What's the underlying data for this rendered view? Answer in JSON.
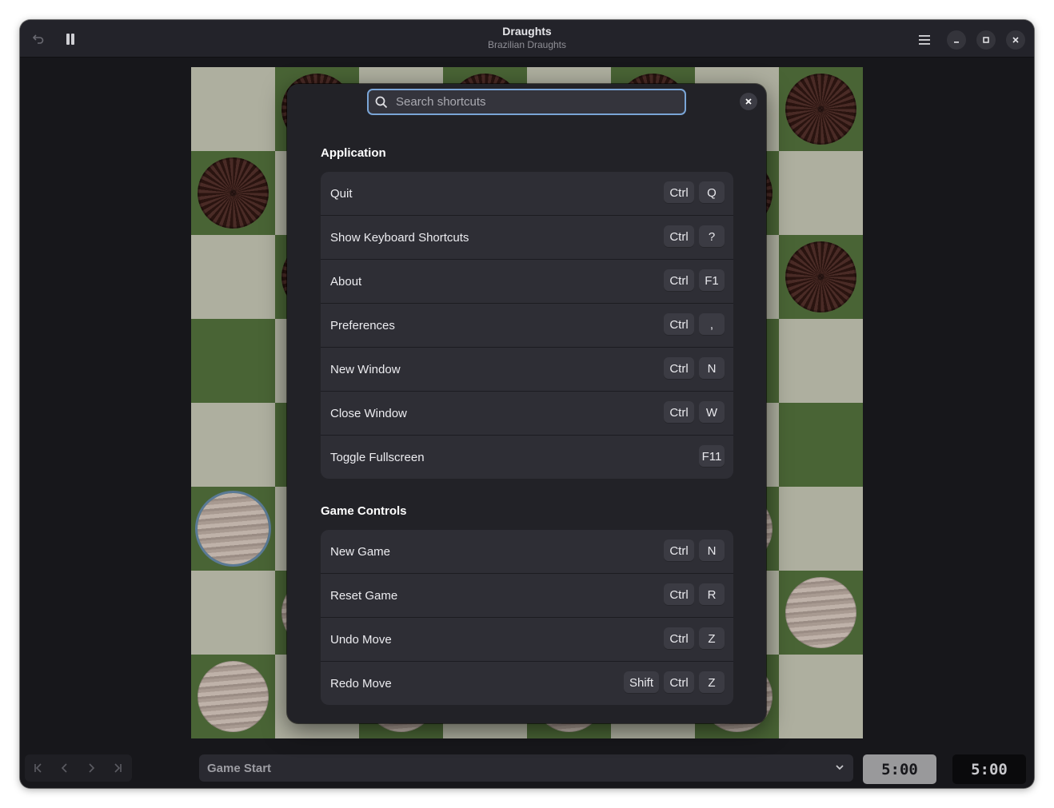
{
  "window": {
    "title": "Draughts",
    "subtitle": "Brazilian Draughts"
  },
  "icons": {
    "undo": "undo-icon",
    "pause": "pause-icon",
    "menu": "hamburger-menu-icon",
    "minimize": "minimize-icon",
    "maximize": "maximize-icon",
    "close": "close-icon"
  },
  "board": {
    "size": 8,
    "light_color": "#aeaf9f",
    "dark_color": "#496435",
    "black_pieces": [
      "0,1",
      "0,3",
      "0,5",
      "0,7",
      "1,0",
      "1,2",
      "1,4",
      "1,6",
      "2,1",
      "2,3",
      "2,5",
      "2,7"
    ],
    "white_pieces": [
      "5,0",
      "5,2",
      "5,4",
      "5,6",
      "6,1",
      "6,3",
      "6,5",
      "6,7",
      "7,0",
      "7,2",
      "7,4",
      "7,6"
    ],
    "selected_piece": "5,0"
  },
  "dialog": {
    "search_placeholder": "Search shortcuts",
    "sections": [
      {
        "title": "Application",
        "items": [
          {
            "label": "Quit",
            "keys": [
              "Ctrl",
              "Q"
            ]
          },
          {
            "label": "Show Keyboard Shortcuts",
            "keys": [
              "Ctrl",
              "?"
            ]
          },
          {
            "label": "About",
            "keys": [
              "Ctrl",
              "F1"
            ]
          },
          {
            "label": "Preferences",
            "keys": [
              "Ctrl",
              ","
            ]
          },
          {
            "label": "New Window",
            "keys": [
              "Ctrl",
              "N"
            ]
          },
          {
            "label": "Close Window",
            "keys": [
              "Ctrl",
              "W"
            ]
          },
          {
            "label": "Toggle Fullscreen",
            "keys": [
              "F11"
            ]
          }
        ]
      },
      {
        "title": "Game Controls",
        "items": [
          {
            "label": "New Game",
            "keys": [
              "Ctrl",
              "N"
            ]
          },
          {
            "label": "Reset Game",
            "keys": [
              "Ctrl",
              "R"
            ]
          },
          {
            "label": "Undo Move",
            "keys": [
              "Ctrl",
              "Z"
            ]
          },
          {
            "label": "Redo Move",
            "keys": [
              "Shift",
              "Ctrl",
              "Z"
            ]
          }
        ]
      }
    ]
  },
  "bottom": {
    "move_selector_value": "Game Start",
    "clock_player1": "5:00",
    "clock_player2": "5:00"
  }
}
